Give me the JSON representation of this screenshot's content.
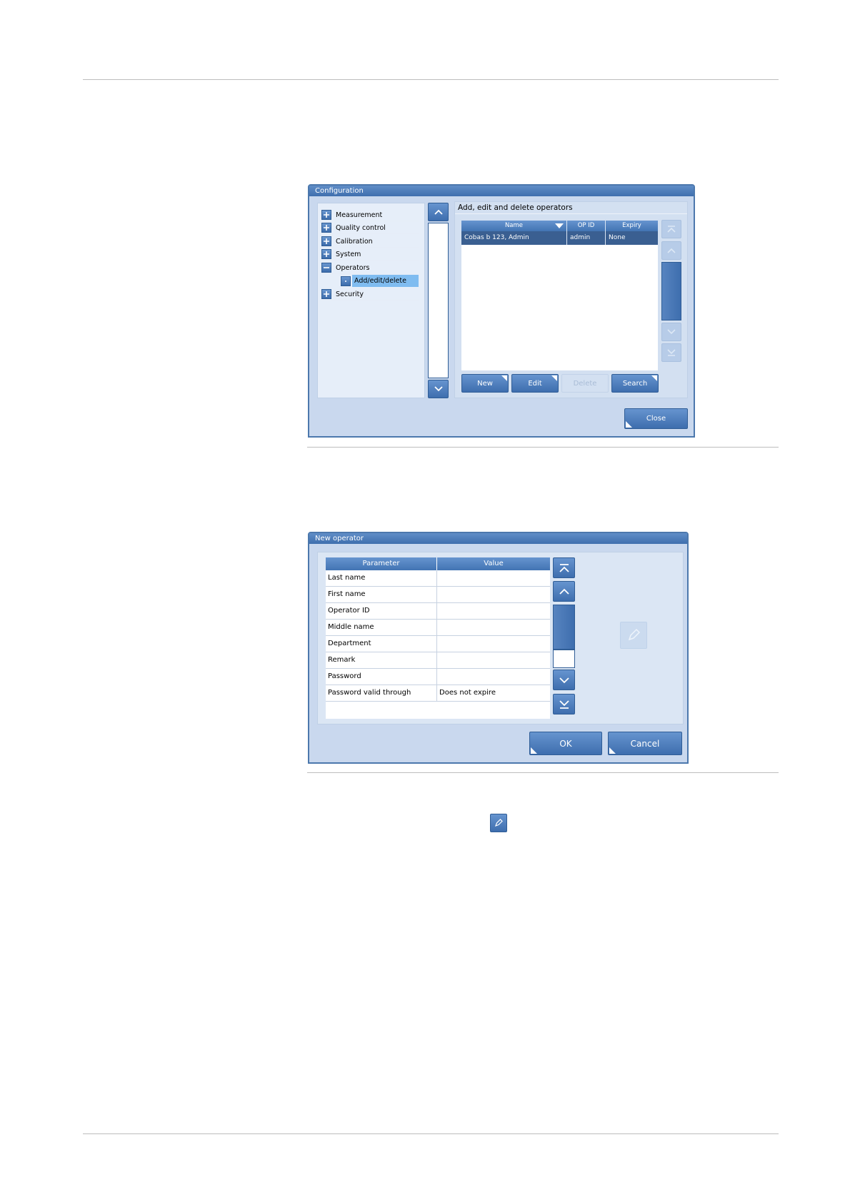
{
  "config_dialog": {
    "title": "Configuration",
    "tree": [
      {
        "label": "Measurement",
        "state": "collapsed"
      },
      {
        "label": "Quality control",
        "state": "collapsed"
      },
      {
        "label": "Calibration",
        "state": "collapsed"
      },
      {
        "label": "System",
        "state": "collapsed"
      },
      {
        "label": "Operators",
        "state": "expanded"
      },
      {
        "label": "Add/edit/delete",
        "state": "selected-child"
      },
      {
        "label": "Security",
        "state": "collapsed"
      }
    ],
    "panel_title": "Add, edit and delete operators",
    "table": {
      "columns": [
        "Name",
        "OP ID",
        "Expiry"
      ],
      "rows": [
        {
          "name": "Cobas b 123, Admin",
          "op_id": "admin",
          "expiry": "None"
        }
      ]
    },
    "buttons": {
      "new": "New",
      "edit": "Edit",
      "delete": "Delete",
      "search": "Search",
      "close": "Close"
    }
  },
  "new_operator_dialog": {
    "title": "New operator",
    "columns": [
      "Parameter",
      "Value"
    ],
    "rows": [
      {
        "param": "Last name",
        "value": ""
      },
      {
        "param": "First name",
        "value": ""
      },
      {
        "param": "Operator ID",
        "value": ""
      },
      {
        "param": "Middle name",
        "value": ""
      },
      {
        "param": "Department",
        "value": ""
      },
      {
        "param": "Remark",
        "value": ""
      },
      {
        "param": "Password",
        "value": ""
      },
      {
        "param": "Password valid through",
        "value": "Does not expire"
      }
    ],
    "buttons": {
      "ok": "OK",
      "cancel": "Cancel"
    }
  },
  "icons": {
    "tree_expand": "plus-icon",
    "tree_collapse": "minus-icon",
    "sort": "sort-down-icon",
    "scroll_top": "double-chevron-up-icon",
    "scroll_up": "chevron-up-icon",
    "scroll_down": "chevron-down-icon",
    "scroll_bottom": "double-chevron-down-icon",
    "edit": "pencil-icon"
  },
  "colors": {
    "accent": "#4a7abb",
    "selected_row": "#3a5f91",
    "tree_selected": "#7fbcf0",
    "dialog_bg": "#c9d8ee"
  }
}
